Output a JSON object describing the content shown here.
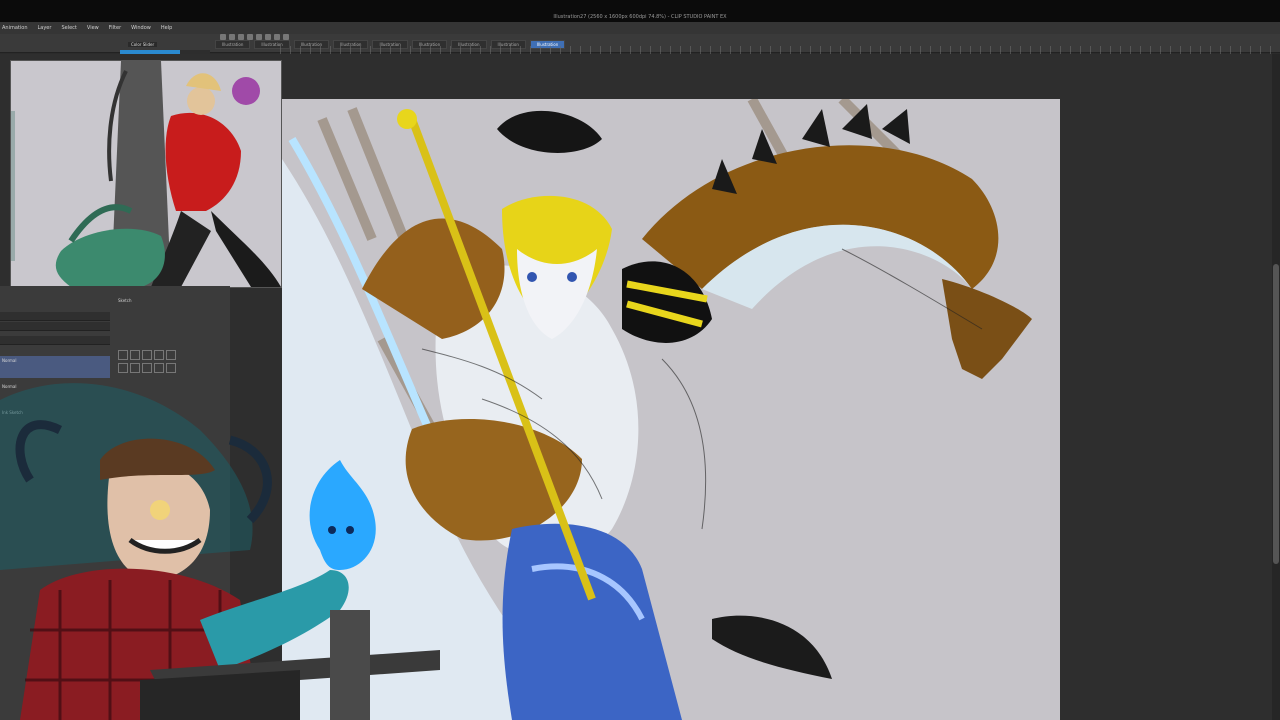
{
  "app": {
    "title": "Illustration27 (2560 x 1600px 600dpi 74.8%) - CLIP STUDIO PAINT EX"
  },
  "menu": {
    "items": [
      "Animation",
      "Layer",
      "Select",
      "View",
      "Filter",
      "Window",
      "Help"
    ]
  },
  "tabs": [
    {
      "label": "Illustration",
      "active": false
    },
    {
      "label": "Illustration",
      "active": false
    },
    {
      "label": "Illustration",
      "active": false
    },
    {
      "label": "Illustration",
      "active": false
    },
    {
      "label": "Illustration",
      "active": false
    },
    {
      "label": "Illustration",
      "active": false
    },
    {
      "label": "Illustration",
      "active": false
    },
    {
      "label": "Illustration",
      "active": false
    },
    {
      "label": "Illustration",
      "active": true
    }
  ],
  "navigator": {
    "label": "Color Slider"
  },
  "layers": {
    "header": "Sketch",
    "items": [
      {
        "name": "Normal"
      },
      {
        "name": "Normal"
      },
      {
        "name": "Ink Sketch"
      }
    ]
  },
  "colors": {
    "accent": "#3f6fb5",
    "canvas_bg": "#c6c4c9",
    "ui_dark": "#2e2e2e",
    "flame": "#2aa8ff"
  },
  "icons": {
    "toolbar": [
      "new-icon",
      "open-icon",
      "save-icon",
      "undo-icon",
      "redo-icon",
      "brush-icon",
      "eraser-icon",
      "fill-icon"
    ]
  }
}
